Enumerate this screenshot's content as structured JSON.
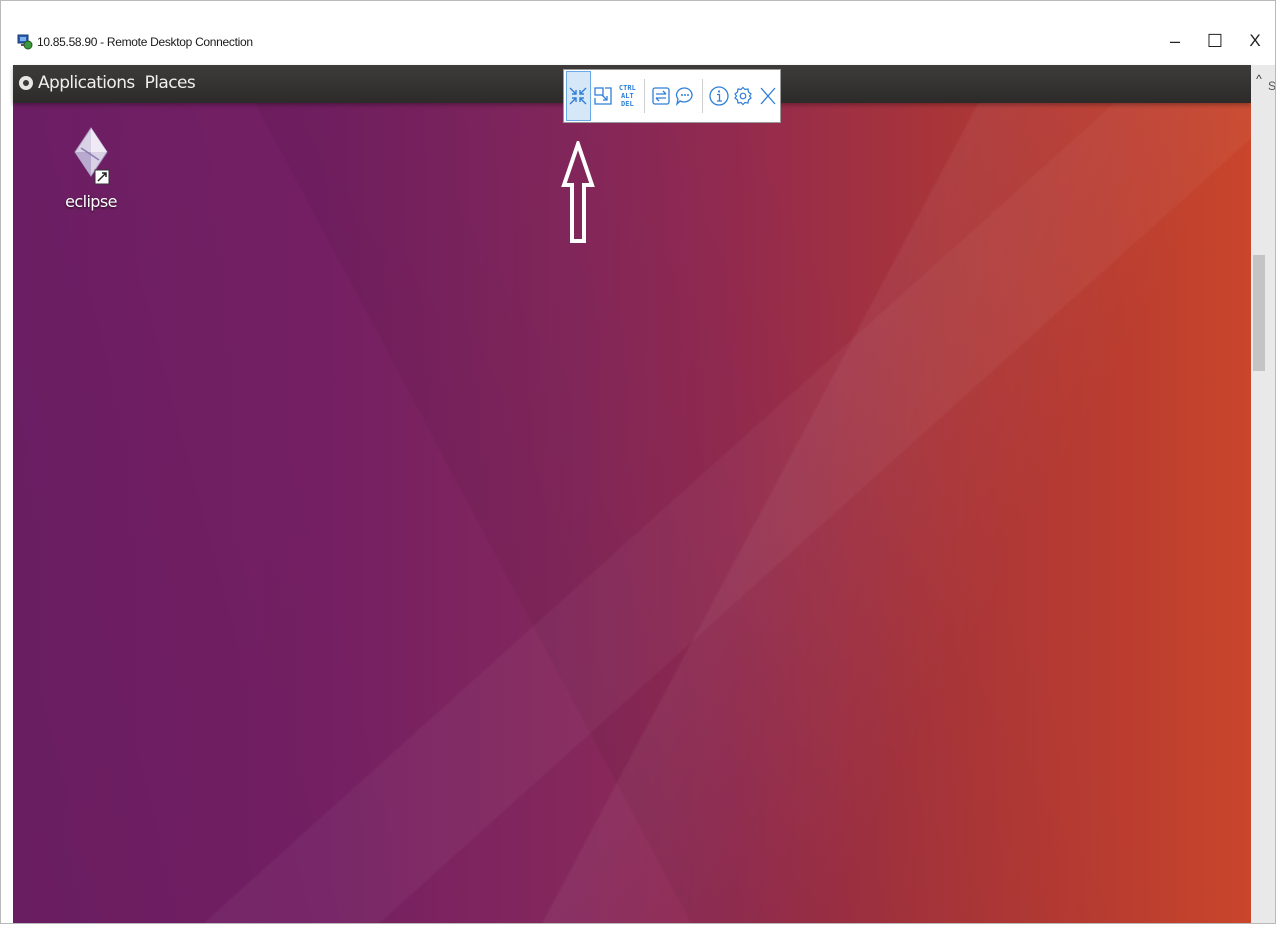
{
  "window": {
    "title": "10.85.58.90 - Remote Desktop Connection",
    "controls": {
      "minimize_glyph": "–",
      "maximize_glyph": "☐",
      "close_glyph": "X"
    }
  },
  "topbar": {
    "menu": {
      "applications": "Applications",
      "places": "Places"
    }
  },
  "rdp_toolbar": {
    "buttons": [
      {
        "icon": "minimize-view-icon",
        "active": true
      },
      {
        "icon": "restore-window-icon",
        "active": false
      },
      {
        "icon": "ctrl-alt-del-icon",
        "lines": [
          "CTRL",
          "ALT",
          "DEL"
        ]
      },
      {
        "icon": "switch-app-icon"
      },
      {
        "icon": "chat-icon"
      },
      {
        "icon": "info-icon"
      },
      {
        "icon": "settings-icon"
      },
      {
        "icon": "close-toolbar-icon"
      }
    ],
    "accent_color": "#2f7fd8"
  },
  "desktop": {
    "icons": [
      {
        "label": "eclipse",
        "icon": "eclipse-shortcut-icon"
      }
    ]
  },
  "scrollbar": {
    "up_glyph": "^",
    "side_letter": "S"
  }
}
